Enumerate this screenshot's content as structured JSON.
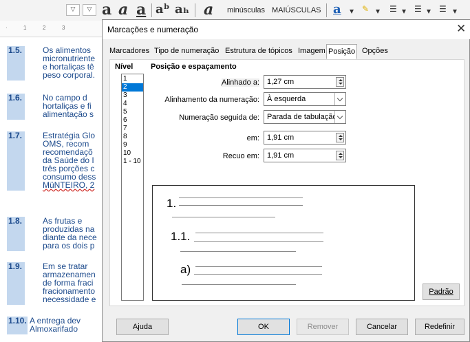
{
  "toolbar": {
    "lowercase_label": "minúsculas",
    "uppercase_label": "MAIÚSCULAS"
  },
  "ruler": {
    "ticks": [
      "1",
      "2",
      "3"
    ]
  },
  "document": {
    "items": [
      {
        "num": "1.5.",
        "lines": [
          "Os alimentos",
          "micronutriente",
          "e hortaliças tê",
          "peso corporal."
        ]
      },
      {
        "num": "1.6.",
        "lines": [
          "No campo d",
          "hortaliças e fi",
          "alimentação s"
        ]
      },
      {
        "num": "1.7.",
        "lines": [
          "Estratégia Glo",
          "OMS, recom",
          "recomendaçõ",
          "da Saúde do I",
          "três porções c",
          "consumo dess",
          "MüNTEIRO, 2"
        ]
      },
      {
        "num": "1.8.",
        "lines": [
          "As frutas e",
          "produzidas na",
          "diante da nece",
          "para os dois p"
        ]
      },
      {
        "num": "1.9.",
        "lines": [
          "Em se tratar",
          "armazenamen",
          "de forma fraci",
          "fracionamento",
          "necessidade e"
        ]
      },
      {
        "num": "1.10.",
        "lines": [
          "A entrega dev",
          "Almoxarifado"
        ]
      }
    ]
  },
  "dialog": {
    "title": "Marcações e numeração",
    "close_icon": "close-icon",
    "tabs": [
      "Marcadores",
      "Tipo de numeração",
      "Estrutura de tópicos",
      "Imagem",
      "Posição",
      "Opções"
    ],
    "active_tab": "Posição",
    "level_label": "Nível",
    "levels": [
      "1",
      "2",
      "3",
      "4",
      "5",
      "6",
      "7",
      "8",
      "9",
      "10",
      "1 - 10"
    ],
    "selected_level": "2",
    "section_title": "Posição e espaçamento",
    "fields": {
      "aligned_at": {
        "label": "Alinhado a:",
        "value": "1,27 cm"
      },
      "numbering_alignment": {
        "label": "Alinhamento da numeração:",
        "value": "À esquerda"
      },
      "numbering_followed_by": {
        "label": "Numeração seguida de:",
        "value": "Parada de tabulação"
      },
      "at": {
        "label": "em:",
        "value": "1,91 cm"
      },
      "indent_at": {
        "label": "Recuo em:",
        "value": "1,91 cm"
      }
    },
    "preview": {
      "level1": "1.",
      "level2": "1.1.",
      "level3": "a)"
    },
    "buttons": {
      "default": "Padrão",
      "help": "Ajuda",
      "ok": "OK",
      "remove": "Remover",
      "cancel": "Cancelar",
      "reset": "Redefinir"
    }
  }
}
